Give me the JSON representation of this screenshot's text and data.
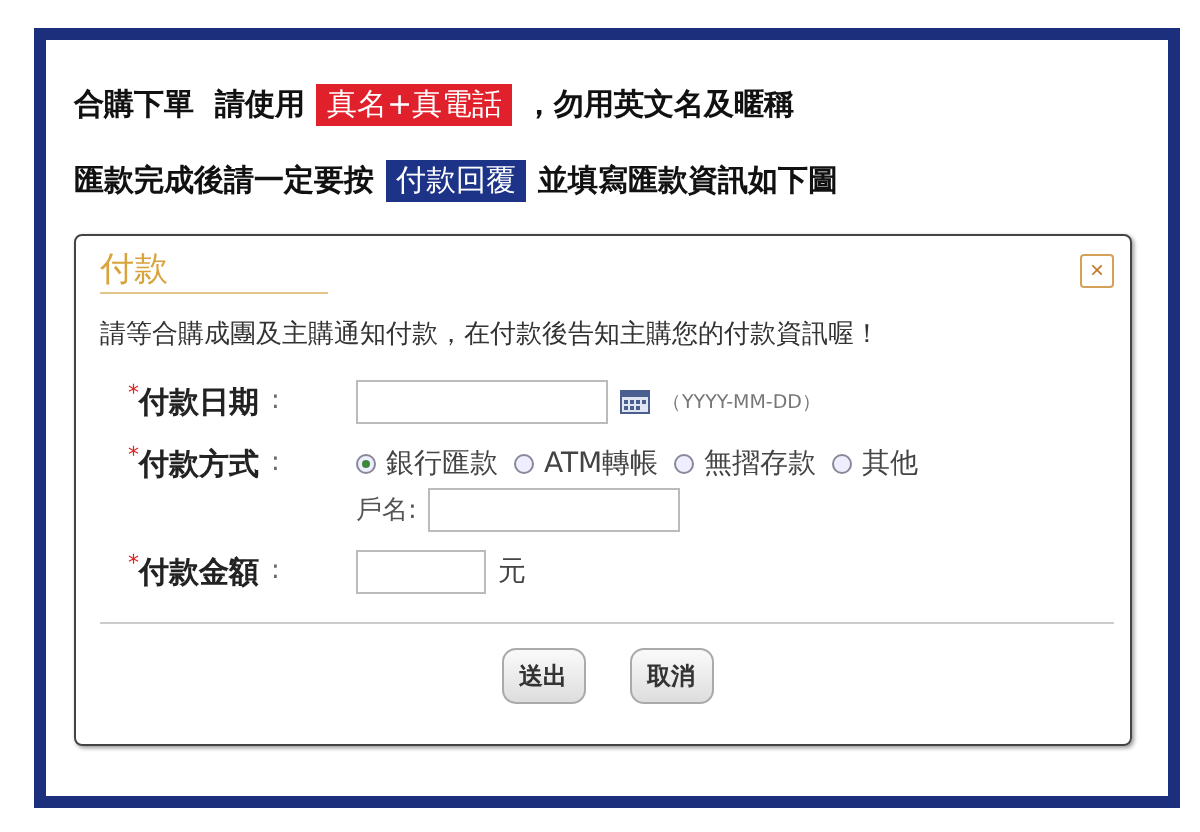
{
  "instructions": [
    {
      "segments": [
        {
          "kind": "plain",
          "text": "合購下單  請使用"
        },
        {
          "kind": "highlight",
          "text": "真名+真電話",
          "color": "#e0202a"
        },
        {
          "kind": "plain",
          "text": "，勿用英文名及暱稱"
        }
      ]
    },
    {
      "segments": [
        {
          "kind": "plain",
          "text": "匯款完成後請一定要按"
        },
        {
          "kind": "highlight",
          "text": "付款回覆",
          "color": "#1c3388"
        },
        {
          "kind": "plain",
          "text": "並填寫匯款資訊如下圖"
        }
      ]
    }
  ],
  "dialog": {
    "title": "付款",
    "close": "×",
    "notice": "請等合購成團及主購通知付款，在付款後告知主購您的付款資訊喔！",
    "fields": [
      {
        "kind": "date",
        "mark": "*",
        "label": "付款日期",
        "colon": ":",
        "hint": "（YYYY-MM-DD）"
      },
      {
        "kind": "radio",
        "mark": "*",
        "label": "付款方式",
        "colon": ":",
        "options": [
          {
            "label": "銀行匯款",
            "selected": true
          },
          {
            "label": "ATM轉帳",
            "selected": false
          },
          {
            "label": "無摺存款",
            "selected": false
          },
          {
            "label": "其他",
            "selected": false
          }
        ],
        "sub_label": "戶名:"
      },
      {
        "kind": "amount",
        "mark": "*",
        "label": "付款金額",
        "colon": ":",
        "unit": "元"
      }
    ],
    "buttons": [
      "送出",
      "取消"
    ]
  }
}
